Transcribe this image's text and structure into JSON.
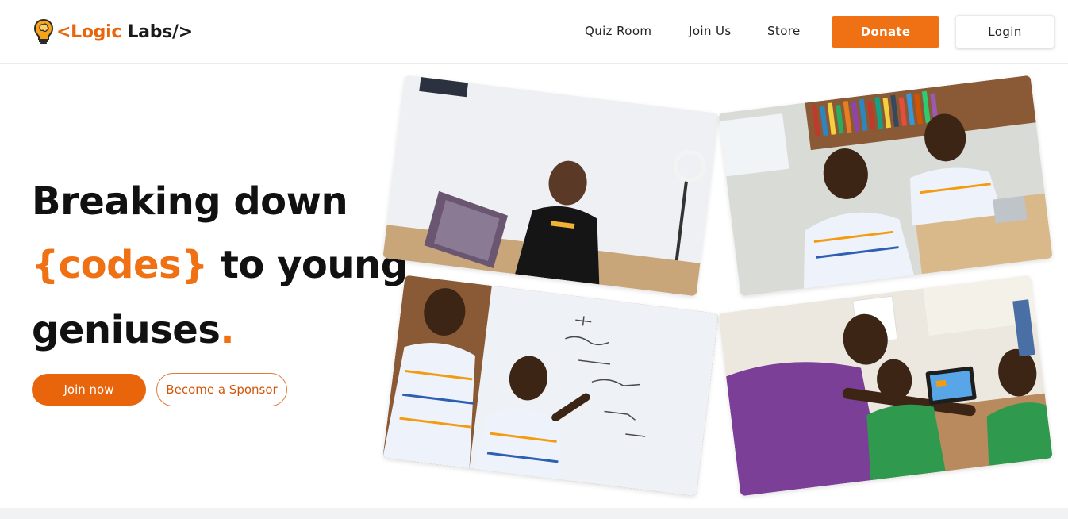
{
  "brand": {
    "logo_open": "<",
    "logo_word1": "Logic",
    "logo_word2": " Labs/>",
    "icon": "lightbulb-brain-icon",
    "accent_color": "#f07014"
  },
  "nav": {
    "links": [
      "Quiz Room",
      "Join Us",
      "Store"
    ],
    "donate_label": "Donate",
    "login_label": "Login"
  },
  "hero": {
    "line1": "Breaking down",
    "line2_accent": "{codes}",
    "line2_rest": " to young",
    "line3": "geniuses",
    "line3_dot": ".",
    "join_label": "Join now",
    "sponsor_label": "Become a Sponsor"
  },
  "gallery": {
    "photos": [
      "boy-at-laptop-photo",
      "students-at-desk-photo",
      "kids-at-whiteboard-photo",
      "students-with-tablet-photo"
    ]
  }
}
